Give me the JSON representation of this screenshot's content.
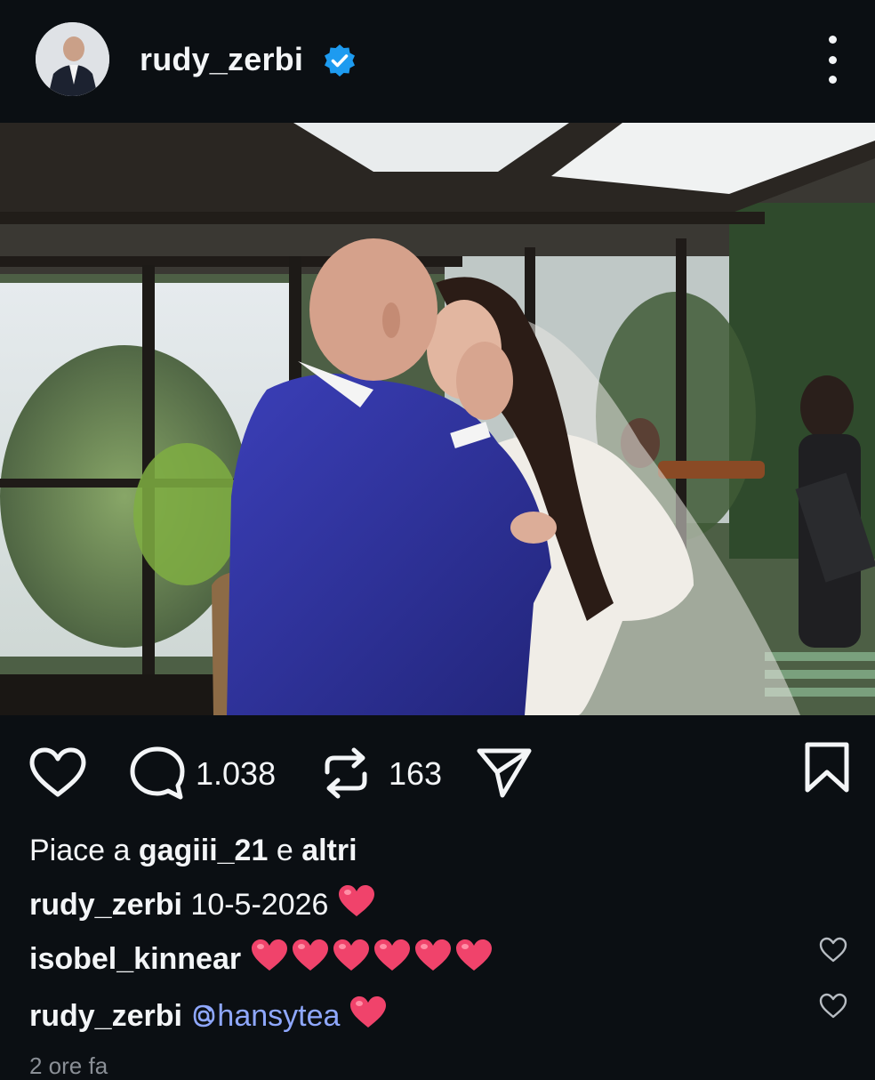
{
  "post": {
    "username": "rudy_zerbi",
    "verified": true
  },
  "actions": {
    "comments_count": "1.038",
    "reposts_count": "163"
  },
  "likes": {
    "prefix": "Piace a",
    "user": "gagiii_21",
    "connector": "e",
    "suffix": "altri"
  },
  "caption": {
    "username": "rudy_zerbi",
    "text": "10-5-2026",
    "emoji": "heart"
  },
  "comments": [
    {
      "username": "isobel_kinnear",
      "hearts": 6
    },
    {
      "username": "rudy_zerbi",
      "mention": "hansytea",
      "hearts": 1
    }
  ],
  "timestamp": "2 ore fa",
  "colors": {
    "background": "#0b0f13",
    "verified": "#1d9bf0",
    "mention": "#8fa8ff",
    "heart_emoji": "#f0436b"
  }
}
